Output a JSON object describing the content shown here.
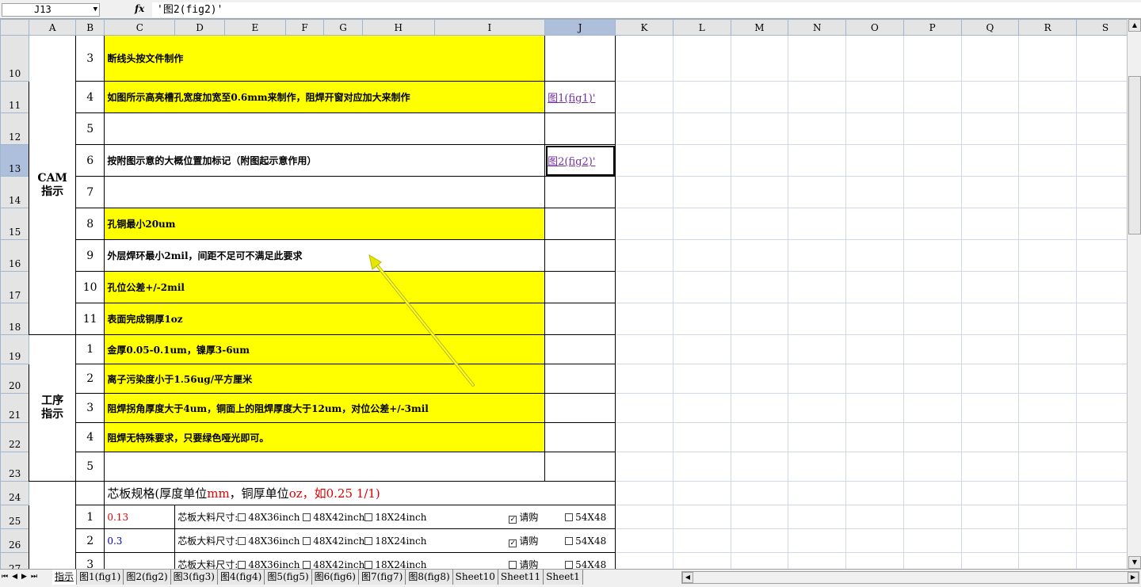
{
  "formula_bar": {
    "name_box": "J13",
    "fx_label": "fx",
    "formula": "'图2(fig2)'"
  },
  "columns": [
    "A",
    "B",
    "C",
    "D",
    "E",
    "F",
    "G",
    "H",
    "I",
    "J",
    "K",
    "L",
    "M",
    "N",
    "O",
    "P",
    "Q",
    "R",
    "S"
  ],
  "selected_column": "J",
  "rows": {
    "r10": "10",
    "r11": "11",
    "r12": "12",
    "r13": "13",
    "r14": "14",
    "r15": "15",
    "r16": "16",
    "r17": "17",
    "r18": "18",
    "r19": "19",
    "r20": "20",
    "r21": "21",
    "r22": "22",
    "r23": "23",
    "r24": "24",
    "r25": "25",
    "r26": "26",
    "r27": "27"
  },
  "cam_group": {
    "label_line1": "CAM",
    "label_line2": "指示"
  },
  "cam_items": [
    {
      "no": "3",
      "text": "断线头按文件制作",
      "link": ""
    },
    {
      "no": "4",
      "text": "如图所示高亮槽孔宽度加宽至0.6mm来制作，阻焊开窗对应加大来制作",
      "link": "图1(fig1)'"
    },
    {
      "no": "5",
      "text": "",
      "link": ""
    },
    {
      "no": "6",
      "text": "按附图示意的大概位置加标记（附图起示意作用）",
      "link": "图2(fig2)'"
    },
    {
      "no": "7",
      "text": "",
      "link": ""
    },
    {
      "no": "8",
      "text": "孔铜最小20um",
      "link": ""
    },
    {
      "no": "9",
      "text": "外层焊环最小2mil，间距不足可不满足此要求",
      "link": ""
    },
    {
      "no": "10",
      "text": "孔位公差+/-2mil",
      "link": ""
    },
    {
      "no": "11",
      "text": "表面完成铜厚1oz",
      "link": ""
    }
  ],
  "process_group": {
    "label_line1": "工序",
    "label_line2": "指示"
  },
  "process_items": [
    {
      "no": "1",
      "text": "金厚0.05-0.1um，镍厚3-6um"
    },
    {
      "no": "2",
      "text": "离子污染度小于1.56ug/平方厘米"
    },
    {
      "no": "3",
      "text": "阻焊拐角厚度大于4um，铜面上的阻焊厚度大于12um，对位公差+/-3mil"
    },
    {
      "no": "4",
      "text": "阻焊无特殊要求，只要绿色哑光即可。"
    },
    {
      "no": "5",
      "text": ""
    }
  ],
  "core_spec": {
    "title_a": "芯板规格(厚度单位",
    "title_b": "mm",
    "title_c": "，铜厚单位",
    "title_d": "oz",
    "title_e": "，如0.25 1/1)",
    "size_label": "芯板大料尺寸:",
    "options": [
      "48X36inch",
      "48X42inch",
      "18X24inch",
      "请购",
      "54X48"
    ],
    "rows": [
      {
        "no": "1",
        "value": "0.13",
        "purchase_checked": "✓"
      },
      {
        "no": "2",
        "value": "0.3",
        "purchase_checked": "✓"
      },
      {
        "no": "3",
        "value": "",
        "purchase_checked": ""
      }
    ]
  },
  "sheet_tabs": [
    "指示",
    "图1(fig1)",
    "图2(fig2)",
    "图3(fig3)",
    "图4(fig4)",
    "图5(fig5)",
    "图6(fig6)",
    "图7(fig7)",
    "图8(fig8)",
    "Sheet10",
    "Sheet11",
    "Sheet1"
  ],
  "active_tab": "指示",
  "colors": {
    "yellow_fill": "#ffff00",
    "link_purple": "#7030a0",
    "header_gray": "#e4e4e4",
    "selected_header": "#aebfdb",
    "arrow": "#e6e600"
  }
}
